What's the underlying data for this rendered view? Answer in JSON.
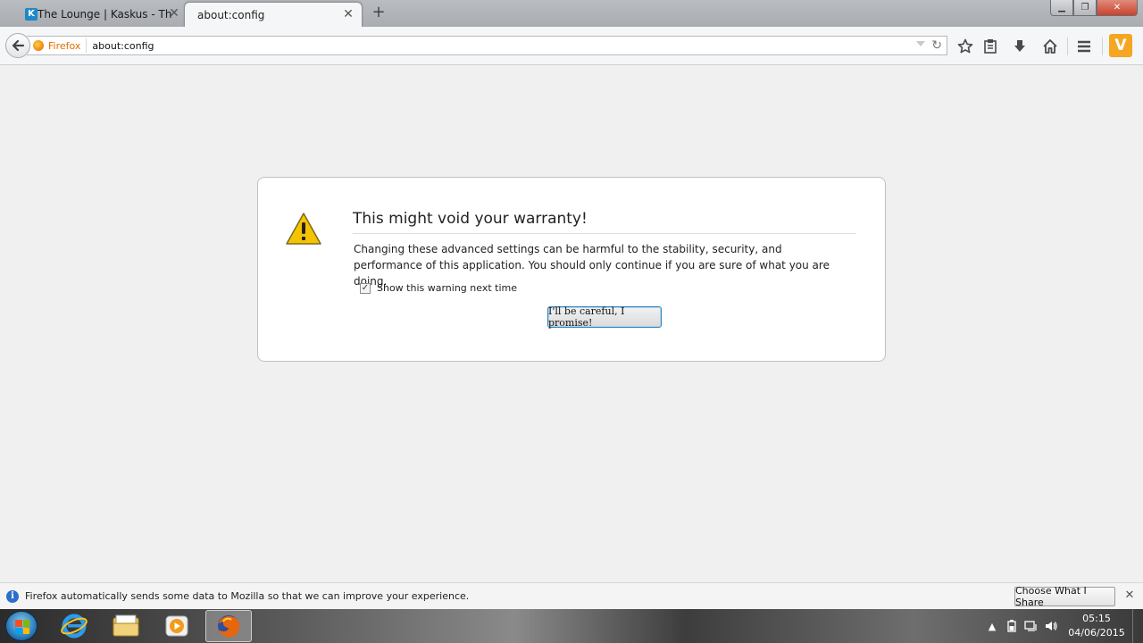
{
  "tabs": [
    {
      "title": "The Lounge | Kaskus - The ...",
      "favicon": "kaskus-favicon",
      "active": false
    },
    {
      "title": "about:config",
      "active": true
    }
  ],
  "navbar": {
    "identity_label": "Firefox",
    "url": "about:config"
  },
  "warning": {
    "title": "This might void your warranty!",
    "text": "Changing these advanced settings can be harmful to the stability, security, and performance of this application. You should only continue if you are sure of what you are doing.",
    "checkbox_label": "Show this warning next time",
    "checkbox_checked": true,
    "button_label": "I'll be careful, I promise!"
  },
  "notification": {
    "text": "Firefox automatically sends some data to Mozilla so that we can improve your experience.",
    "button_label": "Choose What I Share"
  },
  "taskbar": {
    "items": [
      "internet-explorer",
      "windows-explorer",
      "media-player",
      "firefox"
    ],
    "active": "firefox"
  },
  "clock": {
    "time": "05:15",
    "date": "04/06/2015"
  },
  "colors": {
    "firefox_orange": "#e06d00",
    "warning_yellow": "#f5c400",
    "focus_blue": "#3c7fb1"
  }
}
